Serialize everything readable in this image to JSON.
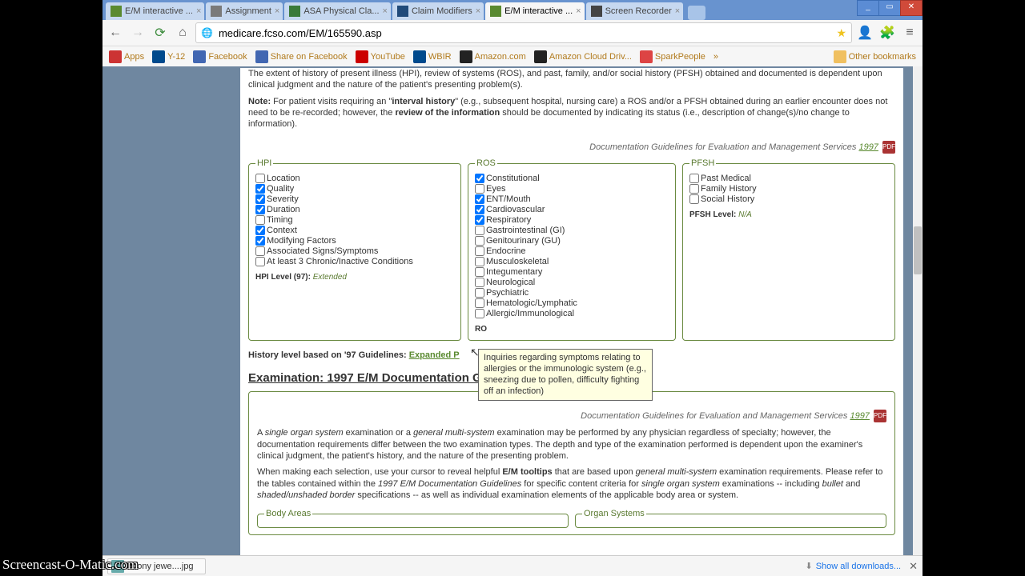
{
  "window": {
    "min": "_",
    "max": "▭",
    "close": "✕"
  },
  "tabs": [
    {
      "title": "E/M interactive ..."
    },
    {
      "title": "Assignment"
    },
    {
      "title": "ASA Physical Cla..."
    },
    {
      "title": "Claim Modifiers"
    },
    {
      "title": "E/M interactive ...",
      "active": true
    },
    {
      "title": "Screen Recorder"
    }
  ],
  "toolbar": {
    "url": "medicare.fcso.com/EM/165590.asp"
  },
  "bookmarks": {
    "items": [
      {
        "label": "Apps"
      },
      {
        "label": "Y-12"
      },
      {
        "label": "Facebook"
      },
      {
        "label": "Share on Facebook"
      },
      {
        "label": "YouTube"
      },
      {
        "label": "WBIR"
      },
      {
        "label": "Amazon.com"
      },
      {
        "label": "Amazon Cloud Driv..."
      },
      {
        "label": "SparkPeople"
      }
    ],
    "overflow": "»",
    "other": "Other bookmarks"
  },
  "page": {
    "intro_tail": "The extent of history of present illness (HPI), review of systems (ROS), and past, family, and/or social history (PFSH) obtained and documented is dependent upon clinical judgment and the nature of the patient's presenting problem(s).",
    "note_label": "Note:",
    "note_text_1": " For patient visits requiring an \"",
    "note_bold_1": "interval history",
    "note_text_2": "\" (e.g., subsequent hospital, nursing care) a ROS and/or a PFSH obtained during an earlier encounter does not need to be re-recorded; however, the ",
    "note_bold_2": "review of the information",
    "note_text_3": " should be documented by indicating its status (i.e., description of change(s)/no change to information).",
    "doc_line_text": "Documentation Guidelines for Evaluation and Management Services ",
    "doc_line_year": "1997",
    "pdf": "PDF",
    "hpi": {
      "legend": "HPI",
      "items": [
        {
          "label": "Location",
          "checked": false
        },
        {
          "label": "Quality",
          "checked": true
        },
        {
          "label": "Severity",
          "checked": true
        },
        {
          "label": "Duration",
          "checked": true
        },
        {
          "label": "Timing",
          "checked": false
        },
        {
          "label": "Context",
          "checked": true
        },
        {
          "label": "Modifying Factors",
          "checked": true
        },
        {
          "label": "Associated Signs/Symptoms",
          "checked": false
        },
        {
          "label": "At least 3 Chronic/Inactive Conditions",
          "checked": false
        }
      ],
      "level_label": "HPI Level (97): ",
      "level_value": "Extended"
    },
    "ros": {
      "legend": "ROS",
      "items": [
        {
          "label": "Constitutional",
          "checked": true
        },
        {
          "label": "Eyes",
          "checked": false
        },
        {
          "label": "ENT/Mouth",
          "checked": true
        },
        {
          "label": "Cardiovascular",
          "checked": true
        },
        {
          "label": "Respiratory",
          "checked": true
        },
        {
          "label": "Gastrointestinal (GI)",
          "checked": false
        },
        {
          "label": "Genitourinary (GU)",
          "checked": false
        },
        {
          "label": "Endocrine",
          "checked": false
        },
        {
          "label": "Musculoskeletal",
          "checked": false
        },
        {
          "label": "Integumentary",
          "checked": false
        },
        {
          "label": "Neurological",
          "checked": false
        },
        {
          "label": "Psychiatric",
          "checked": false
        },
        {
          "label": "Hematologic/Lymphatic",
          "checked": false
        },
        {
          "label": "Allergic/Immunological",
          "checked": false
        }
      ],
      "level_partial": "RO"
    },
    "pfsh": {
      "legend": "PFSH",
      "items": [
        {
          "label": "Past Medical",
          "checked": false
        },
        {
          "label": "Family History",
          "checked": false
        },
        {
          "label": "Social History",
          "checked": false
        }
      ],
      "level_label": "PFSH Level: ",
      "level_value": "N/A"
    },
    "tooltip": "Inquiries regarding symptoms relating to allergies or the immunologic system (e.g., sneezing due to pollen, difficulty fighting off an infection)",
    "history_level_label": "History level based on '97 Guidelines: ",
    "history_level_value": "Expanded P",
    "exam_heading": "Examination: 1997 E/M Documentation Guidelines",
    "exam_p1a": "A ",
    "exam_p1b": "single organ system",
    "exam_p1c": " examination or a ",
    "exam_p1d": "general multi-system",
    "exam_p1e": " examination may be performed by any physician regardless of specialty; however, the documentation requirements differ between the two examination types. The depth and type of the examination performed is dependent upon the examiner's clinical judgment, the patient's history, and the nature of the presenting problem.",
    "exam_p2a": "When making each selection, use your cursor to reveal helpful ",
    "exam_p2b": "E/M tooltips",
    "exam_p2c": " that are based upon ",
    "exam_p2d": "general multi-system",
    "exam_p2e": " examination requirements. Please refer to the tables contained within the ",
    "exam_p2f": "1997 E/M Documentation Guidelines",
    "exam_p2g": " for specific content criteria for ",
    "exam_p2h": "single organ system",
    "exam_p2i": " examinations -- including ",
    "exam_p2j": "bullet",
    "exam_p2k": " and ",
    "exam_p2l": "shaded/unshaded border",
    "exam_p2m": " specifications -- as well as individual examination elements of the applicable body area or system.",
    "body_legend": "Body Areas",
    "organ_legend": "Organ Systems"
  },
  "downloads": {
    "file": "ebony jewe....jpg",
    "showall": "Show all downloads...",
    "close": "✕"
  },
  "watermark": "Screencast-O-Matic.com"
}
